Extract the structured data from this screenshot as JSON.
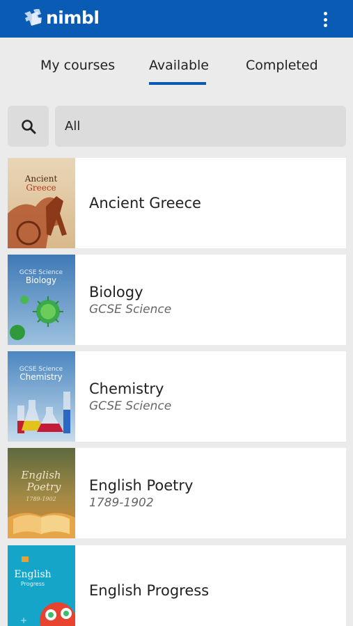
{
  "app": {
    "name": "nimbl",
    "brand_color": "#0a5bb3",
    "logo_icon": "puzzle-cube-icon"
  },
  "header": {
    "menu_icon": "more-vertical-icon"
  },
  "tabs": [
    {
      "label": "My courses",
      "active": false
    },
    {
      "label": "Available",
      "active": true
    },
    {
      "label": "Completed",
      "active": false
    }
  ],
  "search": {
    "icon": "search-icon",
    "filter_value": "All"
  },
  "courses": [
    {
      "title": "Ancient Greece",
      "subtitle": "",
      "cover_title": "Ancient",
      "cover_title_2": "Greece"
    },
    {
      "title": "Biology",
      "subtitle": "GCSE Science",
      "cover_title": "GCSE Science",
      "cover_title_2": "Biology"
    },
    {
      "title": "Chemistry",
      "subtitle": "GCSE Science",
      "cover_title": "GCSE Science",
      "cover_title_2": "Chemistry"
    },
    {
      "title": "English Poetry",
      "subtitle": "1789-1902",
      "cover_title": "English",
      "cover_title_2": "Poetry",
      "cover_title_3": "1789-1902"
    },
    {
      "title": "English Progress",
      "subtitle": "",
      "cover_title": "English",
      "cover_title_2": "Progress"
    }
  ]
}
